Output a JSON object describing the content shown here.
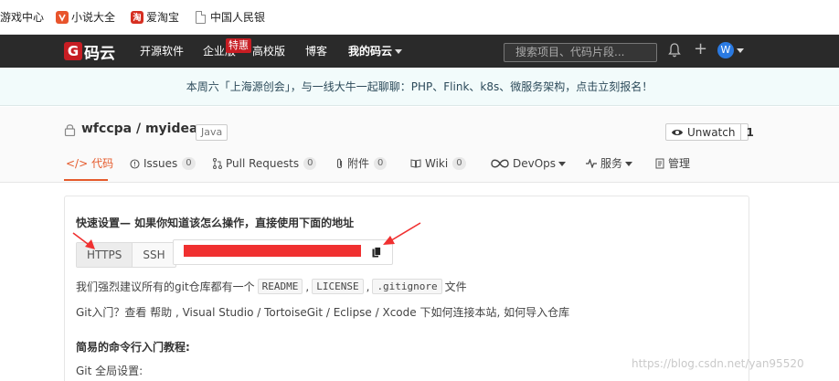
{
  "bookmarks": [
    {
      "label": "游戏中心"
    },
    {
      "label": "小说大全",
      "icon": "novel-icon"
    },
    {
      "label": "爱淘宝",
      "icon": "taobao-icon",
      "glyph": "淘"
    },
    {
      "label": "中国人民银",
      "icon": "page-icon"
    }
  ],
  "nav": {
    "logo_text": "码云",
    "logo_glyph": "G",
    "items": [
      "开源软件",
      "企业版",
      "高校版",
      "博客",
      "我的码云"
    ],
    "special_badge": "特惠",
    "search_placeholder": "搜索项目、代码片段...",
    "avatar_letter": "W"
  },
  "announcement": "本周六「上海源创会」，与一线大牛一起聊聊：PHP、Flink、k8s、微服务架构，点击立刻报名！",
  "repo": {
    "title": "wfccpa / myideas",
    "language": "Java",
    "watch_label": "Unwatch",
    "watch_count": "1"
  },
  "tabs": [
    {
      "label": "代码",
      "glyph": "</>"
    },
    {
      "label": "Issues",
      "count": "0"
    },
    {
      "label": "Pull Requests",
      "count": "0"
    },
    {
      "label": "附件",
      "count": "0"
    },
    {
      "label": "Wiki",
      "count": "0"
    },
    {
      "label": "DevOps"
    },
    {
      "label": "服务"
    },
    {
      "label": "管理"
    }
  ],
  "quick": {
    "title": "快速设置— 如果你知道该怎么操作，直接使用下面的地址",
    "protocols": [
      "HTTPS",
      "SSH"
    ],
    "readme_prefix": "我们强烈建议所有的git仓库都有一个",
    "files": [
      "README",
      "LICENSE",
      ".gitignore"
    ],
    "readme_sep": ",",
    "readme_suffix": "文件",
    "intro": "Git入门？查看 帮助 , Visual Studio / TortoiseGit / Eclipse / Xcode 下如何连接本站, 如何导入仓库",
    "cli_title": "简易的命令行入门教程:",
    "global_setting": "Git 全局设置:"
  },
  "watermark": "https://blog.csdn.net/yan95520",
  "colors": {
    "accent": "#e55a2b",
    "brand": "#c71d23",
    "annotation": "#f03030"
  }
}
